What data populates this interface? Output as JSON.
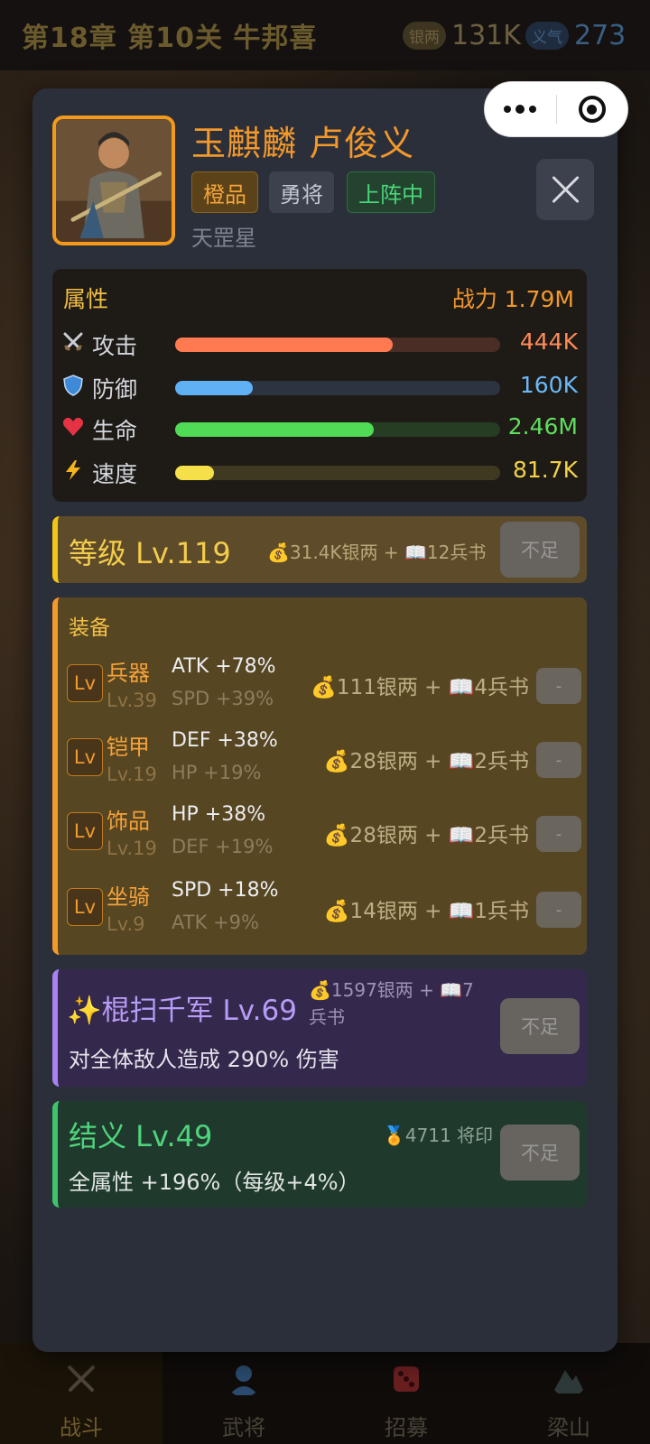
{
  "top_bar": {
    "chapter_title": "第18章 第10关 牛邦喜",
    "silver_tag": "银两",
    "silver_value": "131K",
    "yiqi_tag": "义气",
    "yiqi_value": "273"
  },
  "bottom_nav": [
    {
      "label": "战斗",
      "icon": "crossed-swords-icon",
      "active": true
    },
    {
      "label": "武将",
      "icon": "general-icon",
      "active": false
    },
    {
      "label": "招募",
      "icon": "dice-icon",
      "active": false
    },
    {
      "label": "梁山",
      "icon": "mountain-icon",
      "active": false
    }
  ],
  "hero": {
    "name": "玉麒麟 卢俊义",
    "tags": {
      "quality": "橙品",
      "class": "勇将",
      "status": "上阵中"
    },
    "star": "天罡星"
  },
  "attributes": {
    "title": "属性",
    "power": "战力 1.79M",
    "stats": [
      {
        "label": "攻击",
        "value": "444K",
        "fill": 0.67,
        "icon": "swords-icon",
        "color": "#ff7a50",
        "track": "#4a2e26",
        "value_color": "#ff8a5a"
      },
      {
        "label": "防御",
        "value": "160K",
        "fill": 0.24,
        "icon": "shield-icon",
        "color": "#5fb0f5",
        "track": "#2b3440",
        "value_color": "#6ab9f7"
      },
      {
        "label": "生命",
        "value": "2.46M",
        "fill": 0.61,
        "icon": "heart-icon",
        "color": "#4fdb56",
        "track": "#263d24",
        "value_color": "#5fdd5e"
      },
      {
        "label": "速度",
        "value": "81.7K",
        "fill": 0.12,
        "icon": "lightning-icon",
        "color": "#f6e04a",
        "track": "#3f3922",
        "value_color": "#f3d24b"
      }
    ]
  },
  "level": {
    "title": "等级 Lv.119",
    "cost": "💰31.4K银两 + 📖12兵书",
    "button": "不足"
  },
  "equipment": {
    "title": "装备",
    "badge": "Lv",
    "items": [
      {
        "name": "兵器",
        "level": "Lv.39",
        "main": "ATK +78%",
        "sub": "SPD +39%",
        "cost": "💰111银两 + 📖4兵书",
        "button": "-"
      },
      {
        "name": "铠甲",
        "level": "Lv.19",
        "main": "DEF +38%",
        "sub": "HP +19%",
        "cost": "💰28银两 + 📖2兵书",
        "button": "-"
      },
      {
        "name": "饰品",
        "level": "Lv.19",
        "main": "HP +38%",
        "sub": "DEF +19%",
        "cost": "💰28银两 + 📖2兵书",
        "button": "-"
      },
      {
        "name": "坐骑",
        "level": "Lv.9",
        "main": "SPD +18%",
        "sub": "ATK +9%",
        "cost": "💰14银两 + 📖1兵书",
        "button": "-"
      }
    ]
  },
  "skill": {
    "title": "✨棍扫千军 Lv.69",
    "cost": "💰1597银两 + 📖7兵书",
    "desc": "对全体敌人造成 290% 伤害",
    "button": "不足"
  },
  "bond": {
    "title": "结义 Lv.49",
    "cost": "🏅4711 将印",
    "desc": "全属性 +196%（每级+4%）",
    "button": "不足"
  }
}
